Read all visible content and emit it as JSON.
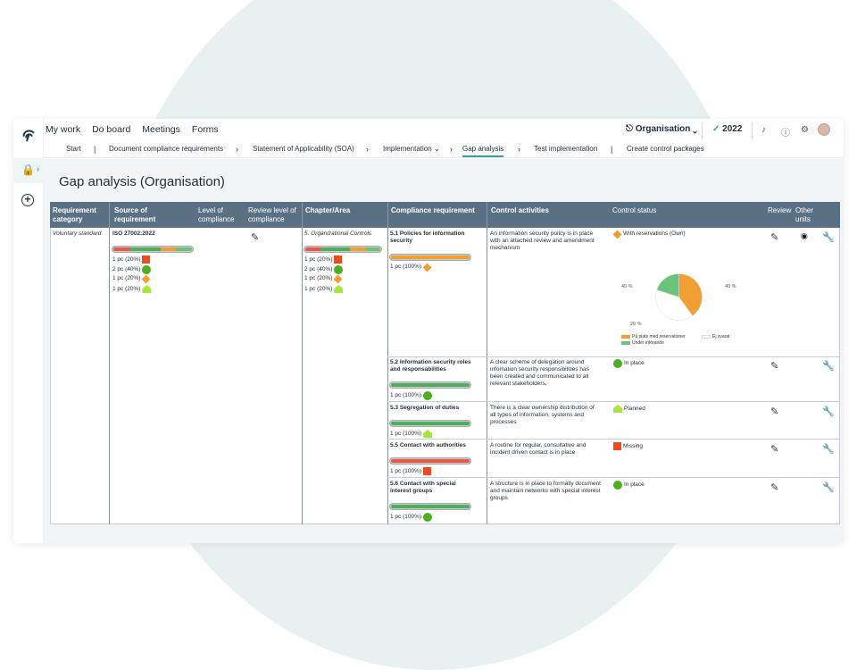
{
  "topnav": [
    "My work",
    "Do board",
    "Meetings",
    "Forms"
  ],
  "org_label": "Organisation",
  "year_label": "2022",
  "breadcrumb": {
    "start": "Start",
    "doc": "Document compliance requirements",
    "soa": "Statement of Applicability (SOA)",
    "impl": "Implementation",
    "gap": "Gap analysis",
    "test": "Test implementation",
    "create": "Create control packages"
  },
  "page_title": "Gap analysis (Organisation)",
  "headers": {
    "req_cat": "Requirement category",
    "source": "Source of requirement",
    "level": "Level of compliance",
    "review_level": "Review level of compliance",
    "chapter": "Chapter/Area",
    "comp_req": "Compliance requirement",
    "control_act": "Control activities",
    "control_status": "Control status",
    "review": "Review",
    "other_units": "Other units"
  },
  "req_category": "Voluntary standard",
  "source": {
    "name": "ISO 27002:2022",
    "stats": [
      "1 pc (20%)",
      "2 pc (40%)",
      "1 pc (20%)",
      "1 pc (20%)"
    ]
  },
  "chapter": {
    "name": "5. Organizational Controls",
    "stats": [
      "1 pc (20%)",
      "2 pc (40%)",
      "1 pc (20%)",
      "1 pc (20%)"
    ]
  },
  "rows": [
    {
      "req": "5.1 Policies for information security",
      "pc": "1 pc (100%)",
      "activity": "An information security policy is in place with an attached review and amendment mechanism",
      "status": "With reservations (Own)"
    },
    {
      "req": "5.2 Information security roles and responsabilities",
      "pc": "1 pc (100%)",
      "activity": "A clear scheme of delegation around infomation security responsibilities has been created and communicated to all relevant stakeholders.",
      "status": "In place"
    },
    {
      "req": "5.3 Segregation of duties",
      "pc": "1 pc (100%)",
      "activity": "There is a clear ownership distribution of all types of information, systems and processes",
      "status": "Planned"
    },
    {
      "req": "5.5 Contact with authorities",
      "pc": "1 pc (100%)",
      "activity": "A routine for regular, consultative and incident driven contact is in place",
      "status": "Missing"
    },
    {
      "req": "5.6 Contact with special interest groups",
      "pc": "1 pc (100%)",
      "activity": "A structure is in place to formally document and maintain networks with special interest groups",
      "status": "In place"
    }
  ],
  "pie": {
    "labels": [
      "40 %",
      "40 %",
      "20 %"
    ],
    "legend": [
      "På plats med reservationer",
      "Ej svarat",
      "Under införande"
    ],
    "values": [
      40,
      40,
      20
    ],
    "colors": [
      "#f0a033",
      "#ffffff",
      "#6cc47a"
    ]
  },
  "colors": {
    "red": "#f04a1e",
    "green": "#4caf1f",
    "orange": "#f0a033",
    "lime": "#a8e63c",
    "header": "#5a7185"
  }
}
